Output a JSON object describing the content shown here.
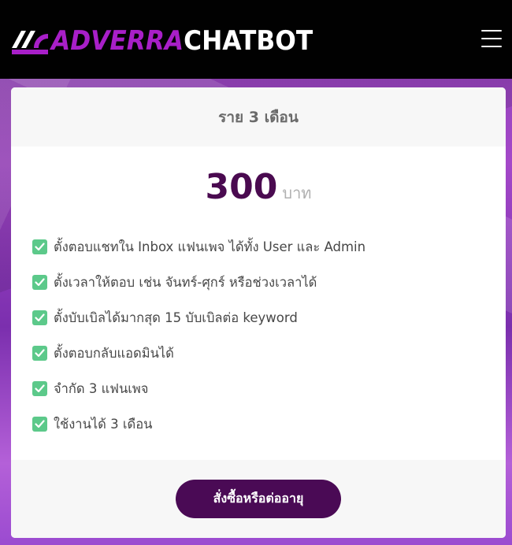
{
  "header": {
    "logo": {
      "brand": "ADVERRA",
      "product": "CHATBOT",
      "brand_color": "#a81fc8"
    },
    "menu_icon": "hamburger-icon"
  },
  "plan": {
    "title": "ราย 3 เดือน",
    "price": "300",
    "currency": "บาท",
    "features": [
      "ตั้งตอบแชทใน Inbox แฟนเพจ ได้ทั้ง User และ Admin",
      "ตั้งเวลาให้ตอบ เช่น จันทร์-ศุกร์ หรือช่วงเวลาได้",
      "ตั้งบับเบิลได้มากสุด 15 บับเบิลต่อ keyword",
      "ตั้งตอบกลับแอดมินได้",
      "จำกัด 3 แฟนเพจ",
      "ใช้งานได้ 3 เดือน"
    ],
    "check_icon": "check-square-icon",
    "check_color": "#5cc98a",
    "order_button": "สั่งซื้อหรือต่ออายุ",
    "accent_color": "#4a0a55"
  }
}
